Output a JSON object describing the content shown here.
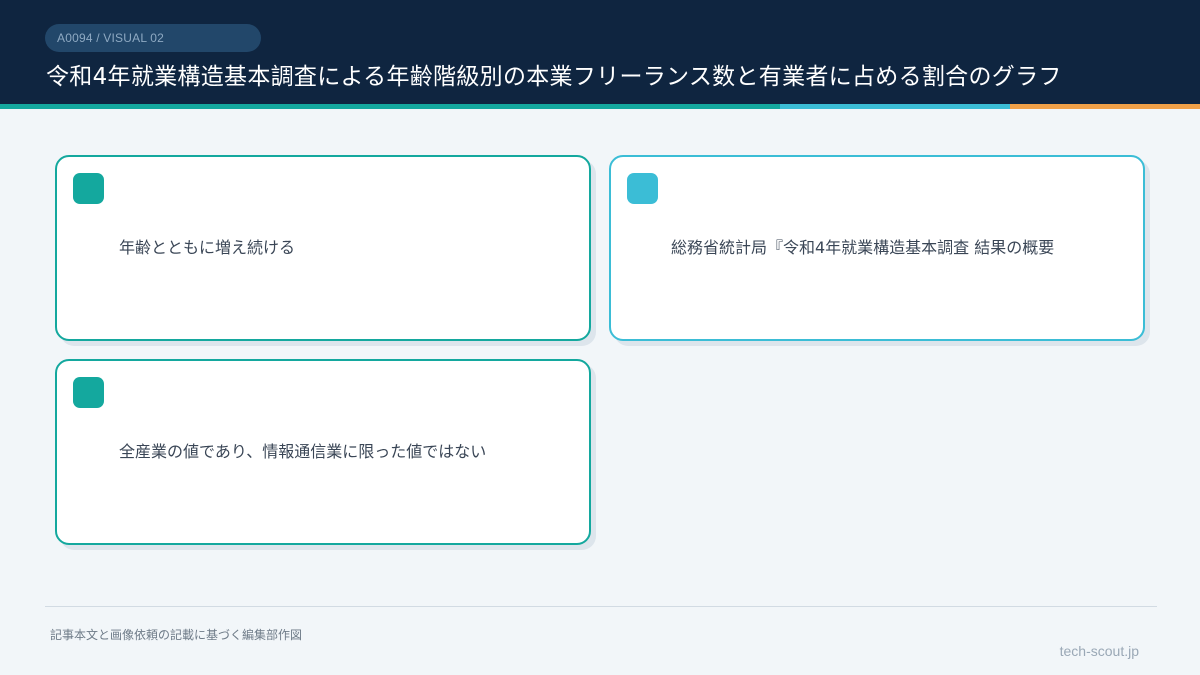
{
  "header": {
    "badge": "A0094 / VISUAL 02",
    "title": "令和4年就業構造基本調査による年齢階級別の本業フリーランス数と有業者に占める割合のグラフ"
  },
  "colors": {
    "header_bg": "#0f2540",
    "teal": "#14a89e",
    "sky": "#3bbdd6",
    "orange": "#f0a048"
  },
  "cards": [
    {
      "text": "年齢とともに増え続ける"
    },
    {
      "text": "総務省統計局『令和4年就業構造基本調査 結果の概要"
    },
    {
      "text": "全産業の値であり、情報通信業に限った値ではない"
    }
  ],
  "footer": {
    "note": "記事本文と画像依頼の記載に基づく編集部作図",
    "site": "tech-scout.jp"
  }
}
